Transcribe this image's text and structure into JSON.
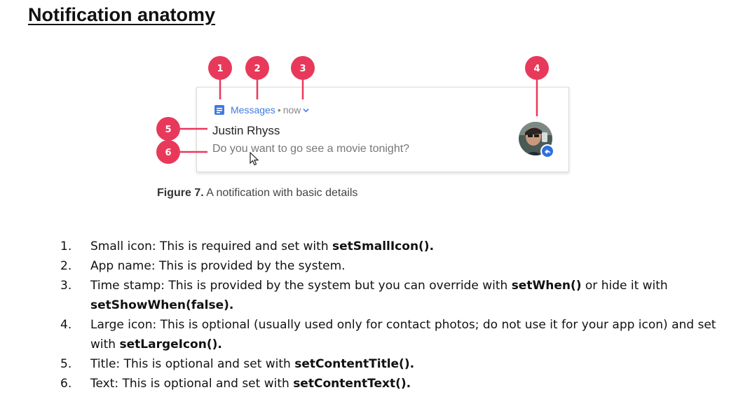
{
  "heading": "Notification anatomy",
  "notification": {
    "app_name": "Messages",
    "separator": "•",
    "time": "now",
    "title": "Justin Rhyss",
    "text": "Do you want to go see a movie tonight?"
  },
  "callouts": [
    "1",
    "2",
    "3",
    "4",
    "5",
    "6"
  ],
  "caption": {
    "label": "Figure 7.",
    "text": " A notification with basic details"
  },
  "items": [
    {
      "num": "1.",
      "text": "Small icon: This is required and set with ",
      "code": "setSmallIcon().",
      "tail": "",
      "code2": ""
    },
    {
      "num": "2.",
      "text": "App name: This is provided by the system.",
      "code": "",
      "tail": "",
      "code2": ""
    },
    {
      "num": "3.",
      "text": "Time stamp: This is provided by the system but you can override with ",
      "code": "setWhen()",
      "tail": " or hide it with ",
      "code2": "setShowWhen(false)."
    },
    {
      "num": "4.",
      "text": "Large icon: This is optional (usually used only for contact photos; do not use it for your app icon) and set with ",
      "code": "setLargeIcon().",
      "tail": "",
      "code2": ""
    },
    {
      "num": "5.",
      "text": "Title: This is optional and set with ",
      "code": "setContentTitle().",
      "tail": "",
      "code2": ""
    },
    {
      "num": "6.",
      "text": "Text: This is optional and set with ",
      "code": "setContentText().",
      "tail": "",
      "code2": ""
    }
  ],
  "colors": {
    "callout": "#e8395b",
    "app_accent": "#3f7be0",
    "reply_badge": "#2f6fe0"
  }
}
